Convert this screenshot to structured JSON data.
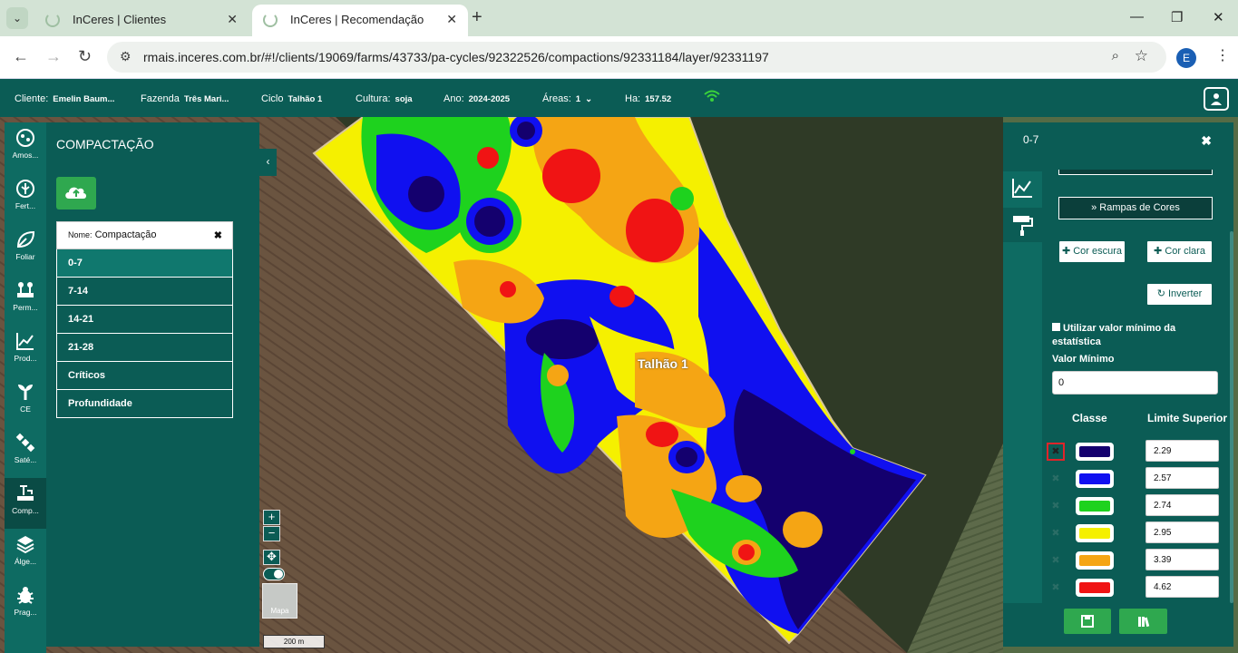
{
  "browser": {
    "tabs": [
      {
        "title": "InCeres | Clientes"
      },
      {
        "title": "InCeres | Recomendação"
      }
    ],
    "url": "rmais.inceres.com.br/#!/clients/19069/farms/43733/pa-cycles/92322526/compactions/92331184/layer/92331197",
    "profile_initial": "E"
  },
  "header": {
    "cliente_label": "Cliente:",
    "cliente_value": "Emelin Baum...",
    "fazenda_label": "Fazenda",
    "fazenda_value": "Três Mari...",
    "ciclo_label": "Ciclo",
    "ciclo_value": "Talhão 1",
    "cultura_label": "Cultura:",
    "cultura_value": "soja",
    "ano_label": "Ano:",
    "ano_value": "2024-2025",
    "areas_label": "Áreas:",
    "areas_value": "1",
    "ha_label": "Ha:",
    "ha_value": "157.52"
  },
  "rail": [
    {
      "label": "Amos...",
      "icon": "sampling-icon"
    },
    {
      "label": "Fert...",
      "icon": "fertilizer-icon"
    },
    {
      "label": "Foliar",
      "icon": "leaf-icon"
    },
    {
      "label": "Perm...",
      "icon": "permanent-crop-icon"
    },
    {
      "label": "Prod...",
      "icon": "productivity-chart-icon"
    },
    {
      "label": "CE",
      "icon": "ce-plant-icon"
    },
    {
      "label": "Saté...",
      "icon": "satellite-icon"
    },
    {
      "label": "Comp...",
      "icon": "compaction-icon"
    },
    {
      "label": "Álge...",
      "icon": "layers-icon"
    },
    {
      "label": "Prag...",
      "icon": "bug-icon"
    }
  ],
  "left_panel": {
    "title": "COMPACTAÇÃO",
    "name_label": "Nome:",
    "name_value": "Compactação",
    "layers": [
      "0-7",
      "7-14",
      "14-21",
      "21-28",
      "Críticos",
      "Profundidade"
    ]
  },
  "map": {
    "plot_label": "Talhão 1",
    "basemap_label": "Mapa",
    "scale": "200 m"
  },
  "right_panel": {
    "title": "0-7",
    "ramps_button": "Rampas de Cores",
    "dark_button": "Cor escura",
    "light_button": "Cor clara",
    "invert_button": "Inverter",
    "min_checkbox": "Utilizar valor mínimo da estatística",
    "min_label": "Valor Mínimo",
    "min_value": "0",
    "col_class": "Classe",
    "col_limit": "Limite Superior",
    "classes": [
      {
        "color": "#14006e",
        "limit": "2.29"
      },
      {
        "color": "#1010f0",
        "limit": "2.57"
      },
      {
        "color": "#1ed21e",
        "limit": "2.74"
      },
      {
        "color": "#f5f000",
        "limit": "2.95"
      },
      {
        "color": "#f5a514",
        "limit": "3.39"
      },
      {
        "color": "#f01414",
        "limit": "4.62"
      }
    ]
  }
}
